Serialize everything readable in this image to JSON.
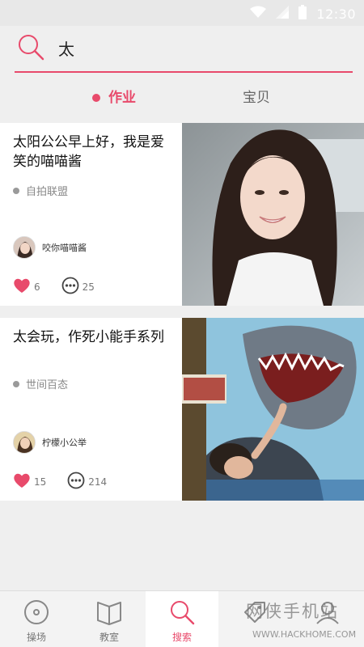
{
  "status_bar": {
    "time": "12:30",
    "icons": [
      "wifi-icon",
      "signal-icon",
      "battery-icon"
    ]
  },
  "search": {
    "query": "太",
    "icon": "search-icon"
  },
  "tabs": [
    {
      "label": "作业",
      "active": true
    },
    {
      "label": "宝贝",
      "active": false
    }
  ],
  "posts": [
    {
      "title": "太阳公公早上好，我是爱笑的喵喵酱",
      "tag": "自拍联盟",
      "author": "咬你喵喵酱",
      "likes": "6",
      "comments": "25"
    },
    {
      "title": "太会玩，作死小能手系列",
      "tag": "世间百态",
      "author": "柠檬小公举",
      "likes": "15",
      "comments": "214"
    }
  ],
  "bottom_nav": [
    {
      "label": "操场",
      "icon": "record-icon",
      "active": false
    },
    {
      "label": "教室",
      "icon": "book-icon",
      "active": false
    },
    {
      "label": "搜索",
      "icon": "search-icon",
      "active": true
    },
    {
      "label": "",
      "icon": "tag-icon",
      "active": false
    },
    {
      "label": "",
      "icon": "profile-icon",
      "active": false
    }
  ],
  "watermark": {
    "text_cn": "网侠手机站",
    "text_en": "WWW.HACKHOME.COM"
  },
  "colors": {
    "accent": "#e84a6b",
    "background": "#efefef",
    "card": "#ffffff"
  }
}
